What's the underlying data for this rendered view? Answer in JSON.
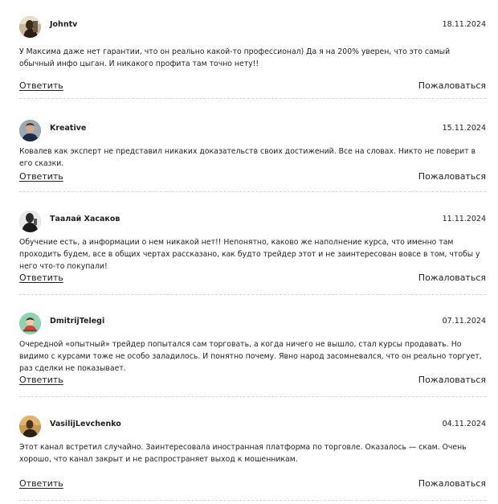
{
  "comments": [
    {
      "author": "Johntv",
      "date": "18.11.2024",
      "text": "У Максима даже нет гарантии, что он реально какой-то профессионал) Да я на 200% уверен, что это самый обычный инфо цыган. И никакого профита там точно нету!!",
      "reply_label": "Ответить",
      "report_label": "Пожаловаться",
      "avatar_icon": "user-photo-avatar-icon"
    },
    {
      "author": "Kreative",
      "date": "15.11.2024",
      "text": "Ковалев как эксперт не представил никаких доказательств своих достижений. Все на словах. Никто не поверит в его сказки.",
      "reply_label": "Ответить",
      "report_label": "Пожаловаться",
      "avatar_icon": "user-photo-avatar-icon"
    },
    {
      "author": "Таалай Хасаков",
      "date": "11.11.2024",
      "text": "Обучение есть, а информации о нем никакой нет!! Непонятно, каково же наполнение курса, что именно там проходить будем, все в общих чертах рассказано, как будто трейдер этот и не заинтересован вовсе в том, чтобы у него что-то покупали!",
      "reply_label": "Ответить",
      "report_label": "Пожаловаться",
      "avatar_icon": "user-photo-avatar-icon"
    },
    {
      "author": "DmitrijTelegi",
      "date": "07.11.2024",
      "text": "Очередной «опытный» трейдер попытался сам торговать, а когда ничего не вышло, стал курсы продавать. Но видимо с курсами тоже не особо заладилось. И понятно почему. Явно народ засомневался, что он реально торгует, раз сделки не показывает.",
      "reply_label": "Ответить",
      "report_label": "Пожаловаться",
      "avatar_icon": "cartoon-avatar-icon"
    },
    {
      "author": "VasilijLevchenko",
      "date": "04.11.2024",
      "text": "Этот канал встретил случайно. Заинтересовала иностранная платформа по торговле. Оказалось — скам. Очень хорошо, что канал закрыт и не распространяет выход к мошенникам.",
      "reply_label": "Ответить",
      "report_label": "Пожаловаться",
      "avatar_icon": "user-photo-avatar-icon"
    }
  ]
}
